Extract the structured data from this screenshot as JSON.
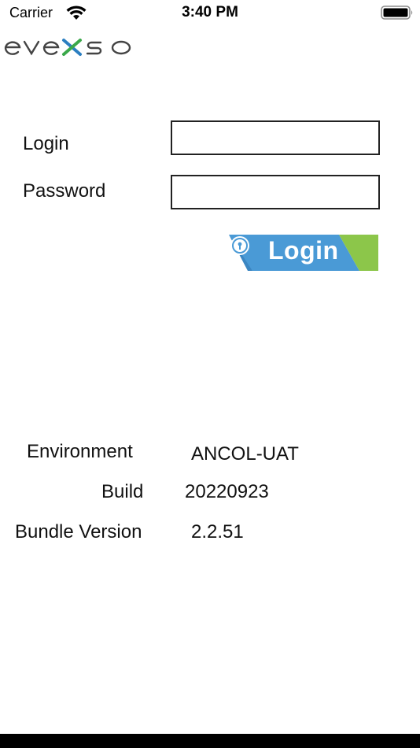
{
  "status_bar": {
    "carrier": "Carrier",
    "time": "3:40 PM",
    "wifi_icon": "wifi-icon",
    "battery_icon": "battery-icon"
  },
  "logo": {
    "text": "evexso",
    "colors": {
      "letters": "#444444",
      "x_blue": "#2c7fc1",
      "x_green": "#3aa84a"
    }
  },
  "form": {
    "login_label": "Login",
    "login_value": "",
    "password_label": "Password",
    "password_value": "",
    "submit_label": "Login",
    "submit_icon": "lock-icon",
    "colors": {
      "button_blue": "#4a9ad6",
      "button_green": "#8cc64a"
    }
  },
  "info": {
    "environment_label": "Environment",
    "environment_value": "ANCOL-UAT",
    "build_label": "Build",
    "build_value": "20220923",
    "bundle_label": "Bundle Version",
    "bundle_value": "2.2.51"
  }
}
